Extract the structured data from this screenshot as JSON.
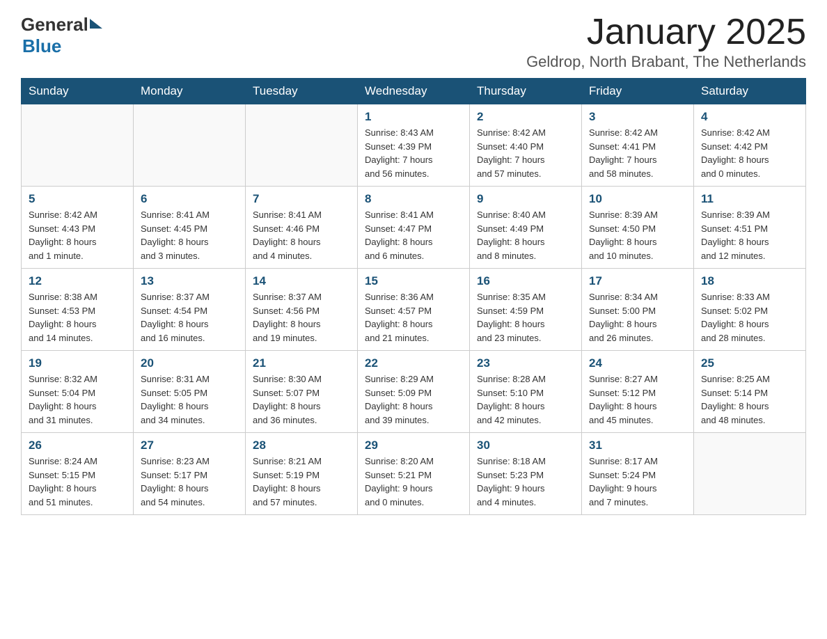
{
  "header": {
    "logo_general": "General",
    "logo_blue": "Blue",
    "month_title": "January 2025",
    "location": "Geldrop, North Brabant, The Netherlands"
  },
  "days_of_week": [
    "Sunday",
    "Monday",
    "Tuesday",
    "Wednesday",
    "Thursday",
    "Friday",
    "Saturday"
  ],
  "weeks": [
    [
      {
        "day": "",
        "info": ""
      },
      {
        "day": "",
        "info": ""
      },
      {
        "day": "",
        "info": ""
      },
      {
        "day": "1",
        "info": "Sunrise: 8:43 AM\nSunset: 4:39 PM\nDaylight: 7 hours\nand 56 minutes."
      },
      {
        "day": "2",
        "info": "Sunrise: 8:42 AM\nSunset: 4:40 PM\nDaylight: 7 hours\nand 57 minutes."
      },
      {
        "day": "3",
        "info": "Sunrise: 8:42 AM\nSunset: 4:41 PM\nDaylight: 7 hours\nand 58 minutes."
      },
      {
        "day": "4",
        "info": "Sunrise: 8:42 AM\nSunset: 4:42 PM\nDaylight: 8 hours\nand 0 minutes."
      }
    ],
    [
      {
        "day": "5",
        "info": "Sunrise: 8:42 AM\nSunset: 4:43 PM\nDaylight: 8 hours\nand 1 minute."
      },
      {
        "day": "6",
        "info": "Sunrise: 8:41 AM\nSunset: 4:45 PM\nDaylight: 8 hours\nand 3 minutes."
      },
      {
        "day": "7",
        "info": "Sunrise: 8:41 AM\nSunset: 4:46 PM\nDaylight: 8 hours\nand 4 minutes."
      },
      {
        "day": "8",
        "info": "Sunrise: 8:41 AM\nSunset: 4:47 PM\nDaylight: 8 hours\nand 6 minutes."
      },
      {
        "day": "9",
        "info": "Sunrise: 8:40 AM\nSunset: 4:49 PM\nDaylight: 8 hours\nand 8 minutes."
      },
      {
        "day": "10",
        "info": "Sunrise: 8:39 AM\nSunset: 4:50 PM\nDaylight: 8 hours\nand 10 minutes."
      },
      {
        "day": "11",
        "info": "Sunrise: 8:39 AM\nSunset: 4:51 PM\nDaylight: 8 hours\nand 12 minutes."
      }
    ],
    [
      {
        "day": "12",
        "info": "Sunrise: 8:38 AM\nSunset: 4:53 PM\nDaylight: 8 hours\nand 14 minutes."
      },
      {
        "day": "13",
        "info": "Sunrise: 8:37 AM\nSunset: 4:54 PM\nDaylight: 8 hours\nand 16 minutes."
      },
      {
        "day": "14",
        "info": "Sunrise: 8:37 AM\nSunset: 4:56 PM\nDaylight: 8 hours\nand 19 minutes."
      },
      {
        "day": "15",
        "info": "Sunrise: 8:36 AM\nSunset: 4:57 PM\nDaylight: 8 hours\nand 21 minutes."
      },
      {
        "day": "16",
        "info": "Sunrise: 8:35 AM\nSunset: 4:59 PM\nDaylight: 8 hours\nand 23 minutes."
      },
      {
        "day": "17",
        "info": "Sunrise: 8:34 AM\nSunset: 5:00 PM\nDaylight: 8 hours\nand 26 minutes."
      },
      {
        "day": "18",
        "info": "Sunrise: 8:33 AM\nSunset: 5:02 PM\nDaylight: 8 hours\nand 28 minutes."
      }
    ],
    [
      {
        "day": "19",
        "info": "Sunrise: 8:32 AM\nSunset: 5:04 PM\nDaylight: 8 hours\nand 31 minutes."
      },
      {
        "day": "20",
        "info": "Sunrise: 8:31 AM\nSunset: 5:05 PM\nDaylight: 8 hours\nand 34 minutes."
      },
      {
        "day": "21",
        "info": "Sunrise: 8:30 AM\nSunset: 5:07 PM\nDaylight: 8 hours\nand 36 minutes."
      },
      {
        "day": "22",
        "info": "Sunrise: 8:29 AM\nSunset: 5:09 PM\nDaylight: 8 hours\nand 39 minutes."
      },
      {
        "day": "23",
        "info": "Sunrise: 8:28 AM\nSunset: 5:10 PM\nDaylight: 8 hours\nand 42 minutes."
      },
      {
        "day": "24",
        "info": "Sunrise: 8:27 AM\nSunset: 5:12 PM\nDaylight: 8 hours\nand 45 minutes."
      },
      {
        "day": "25",
        "info": "Sunrise: 8:25 AM\nSunset: 5:14 PM\nDaylight: 8 hours\nand 48 minutes."
      }
    ],
    [
      {
        "day": "26",
        "info": "Sunrise: 8:24 AM\nSunset: 5:15 PM\nDaylight: 8 hours\nand 51 minutes."
      },
      {
        "day": "27",
        "info": "Sunrise: 8:23 AM\nSunset: 5:17 PM\nDaylight: 8 hours\nand 54 minutes."
      },
      {
        "day": "28",
        "info": "Sunrise: 8:21 AM\nSunset: 5:19 PM\nDaylight: 8 hours\nand 57 minutes."
      },
      {
        "day": "29",
        "info": "Sunrise: 8:20 AM\nSunset: 5:21 PM\nDaylight: 9 hours\nand 0 minutes."
      },
      {
        "day": "30",
        "info": "Sunrise: 8:18 AM\nSunset: 5:23 PM\nDaylight: 9 hours\nand 4 minutes."
      },
      {
        "day": "31",
        "info": "Sunrise: 8:17 AM\nSunset: 5:24 PM\nDaylight: 9 hours\nand 7 minutes."
      },
      {
        "day": "",
        "info": ""
      }
    ]
  ]
}
